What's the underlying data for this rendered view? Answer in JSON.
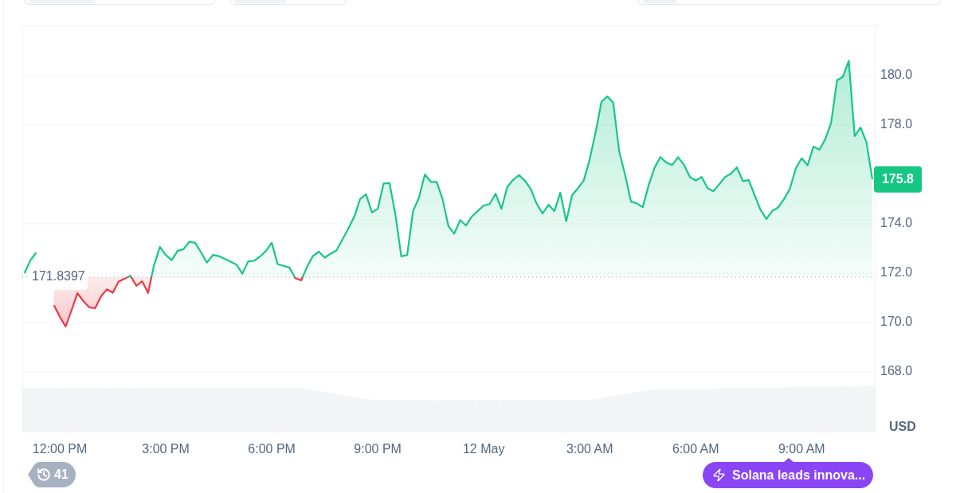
{
  "chart": {
    "chart_data": {
      "type": "area",
      "ylabel": "USD",
      "grid": true,
      "ylim": [
        165.55,
        182.03
      ],
      "categories": [
        null,
        null,
        null,
        null,
        null,
        null,
        "12:00 PM",
        null,
        null,
        null,
        null,
        null,
        null,
        null,
        null,
        null,
        null,
        null,
        null,
        null,
        null,
        null,
        null,
        null,
        "3:00 PM",
        null,
        null,
        null,
        null,
        null,
        null,
        null,
        null,
        null,
        null,
        null,
        null,
        null,
        null,
        null,
        null,
        null,
        "6:00 PM",
        null,
        null,
        null,
        null,
        null,
        null,
        null,
        null,
        null,
        null,
        null,
        null,
        null,
        null,
        null,
        null,
        null,
        "9:00 PM",
        null,
        null,
        null,
        null,
        null,
        null,
        null,
        null,
        null,
        null,
        null,
        null,
        null,
        null,
        null,
        null,
        null,
        "12 May",
        null,
        null,
        null,
        null,
        null,
        null,
        null,
        null,
        null,
        null,
        null,
        null,
        null,
        null,
        null,
        null,
        null,
        "3:00 AM",
        null,
        null,
        null,
        null,
        null,
        null,
        null,
        null,
        null,
        null,
        null,
        null,
        null,
        null,
        null,
        null,
        null,
        "6:00 AM",
        null,
        null,
        null,
        null,
        null,
        null,
        null,
        null,
        null,
        null,
        null,
        null,
        null,
        null,
        null,
        null,
        null,
        "9:00 AM",
        null,
        null,
        null,
        null,
        null,
        null,
        null,
        null,
        null,
        null,
        null,
        null
      ],
      "yticks": [
        {
          "value": 168,
          "label": "168.0"
        },
        {
          "value": 170,
          "label": "170.0"
        },
        {
          "value": 172,
          "label": "172.0"
        },
        {
          "value": 174,
          "label": "174.0"
        },
        {
          "value": 178,
          "label": "178.0"
        },
        {
          "value": 180,
          "label": "180.0"
        }
      ],
      "series": [
        {
          "color": "#16c784",
          "values": [
            172.0,
            172.52,
            172.84,
            null,
            null,
            170.7,
            170.24,
            169.84,
            170.5,
            171.19,
            170.87,
            170.62,
            170.58,
            171.06,
            171.35,
            171.21,
            171.66,
            171.77,
            171.9,
            171.49,
            171.67,
            171.2,
            172.32,
            173.06,
            172.74,
            172.53,
            172.9,
            172.97,
            173.27,
            173.23,
            172.84,
            172.43,
            172.74,
            172.69,
            172.58,
            172.47,
            172.35,
            171.98,
            172.48,
            172.5,
            172.67,
            172.9,
            173.23,
            172.36,
            172.3,
            172.23,
            171.8,
            171.71,
            172.26,
            172.7,
            172.87,
            172.63,
            172.79,
            172.92,
            173.36,
            173.81,
            174.28,
            175.0,
            175.2,
            174.46,
            174.61,
            175.63,
            175.65,
            174.38,
            172.68,
            172.74,
            174.52,
            175.06,
            176.0,
            175.7,
            175.7,
            175.0,
            173.9,
            173.6,
            174.15,
            173.93,
            174.3,
            174.52,
            174.74,
            174.8,
            175.22,
            174.61,
            175.5,
            175.78,
            175.97,
            175.74,
            175.41,
            174.81,
            174.42,
            174.77,
            174.52,
            175.26,
            174.1,
            175.16,
            175.44,
            175.76,
            176.61,
            177.7,
            178.94,
            179.16,
            178.9,
            176.93,
            175.99,
            174.9,
            174.83,
            174.67,
            175.55,
            176.26,
            176.7,
            176.48,
            176.38,
            176.7,
            176.39,
            175.9,
            175.75,
            175.9,
            175.44,
            175.32,
            175.6,
            175.9,
            176.03,
            176.29,
            175.73,
            175.77,
            175.16,
            174.57,
            174.2,
            174.52,
            174.66,
            175.0,
            175.42,
            176.25,
            176.65,
            176.37,
            177.13,
            177.0,
            177.42,
            178.1,
            179.81,
            179.95,
            180.6,
            177.55,
            177.9,
            177.3,
            175.8
          ]
        }
      ],
      "ref_lines": [
        {
          "axis": "y",
          "value": 171.8397,
          "label": "171.8397"
        }
      ],
      "annotations": [
        "175.8"
      ]
    }
  },
  "history_badge": {
    "count": "41"
  },
  "news_badge": {
    "text": "Solana leads innova..."
  }
}
